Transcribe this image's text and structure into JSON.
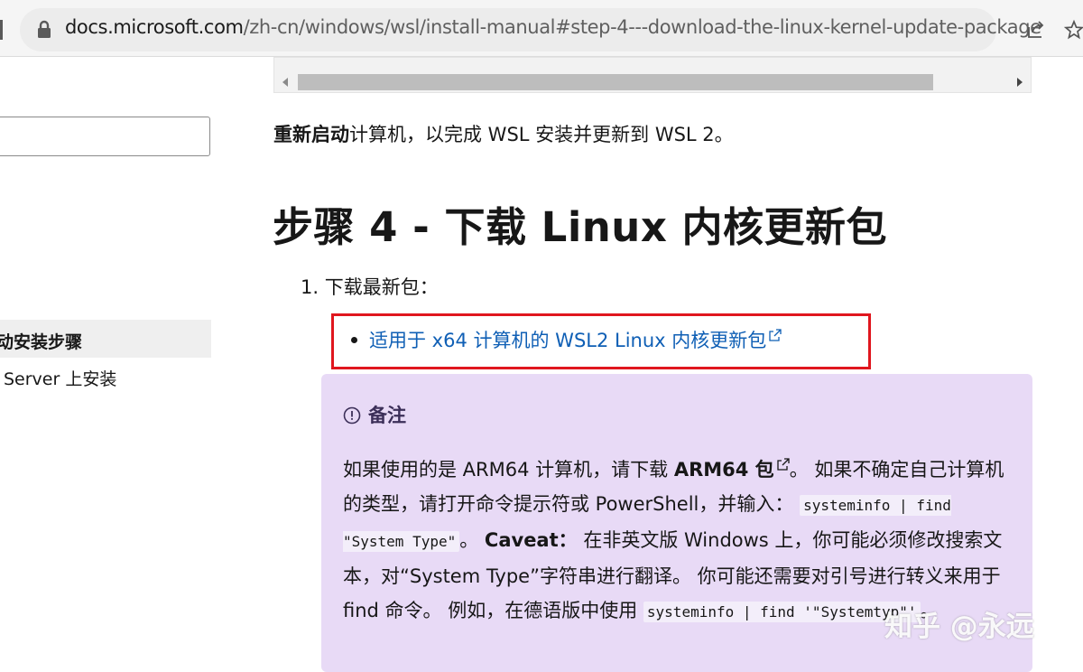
{
  "browser": {
    "url_host": "docs.microsoft.com",
    "url_path": "/zh-cn/windows/wsl/install-manual#step-4---download-the-linux-kernel-update-package",
    "icons": [
      "lock-icon",
      "share-icon",
      "favorite-star-icon"
    ]
  },
  "sidebar": {
    "active_item": "动安装步骤",
    "item": "Server 上安装"
  },
  "content": {
    "restart_bold": "重新启动",
    "restart_rest": "计算机，以完成 WSL 安装并更新到 WSL 2。",
    "heading": "步骤 4 - 下载 Linux 内核更新包",
    "list_item": "1. 下载最新包：",
    "download_link": "适用于 x64 计算机的 WSL2 Linux 内核更新包"
  },
  "note": {
    "title": "备注",
    "t1": "如果使用的是 ARM64 计算机，请下载 ",
    "arm_link": "ARM64 包",
    "t2": "。 如果不确定自己计算机的类型，请打开命令提示符或 PowerShell，并输入：",
    "code1": "systeminfo | find \"System Type\"",
    "t3": "。 ",
    "caveat": "Caveat：",
    "t4": " 在非英文版 Windows 上，你可能必须修改搜索文本，对“System Type”字符串进行翻译。 你可能还需要对引号进行转义来用于 find 命令。 例如，在德语版中使用 ",
    "code2": "systeminfo | find '\"Systemtyp\"'",
    "t5": "。"
  },
  "watermark": "知乎 @永远",
  "colors": {
    "link": "#0f5fb5",
    "highlight_box": "#e0161e",
    "note_bg": "#e8daf6"
  }
}
